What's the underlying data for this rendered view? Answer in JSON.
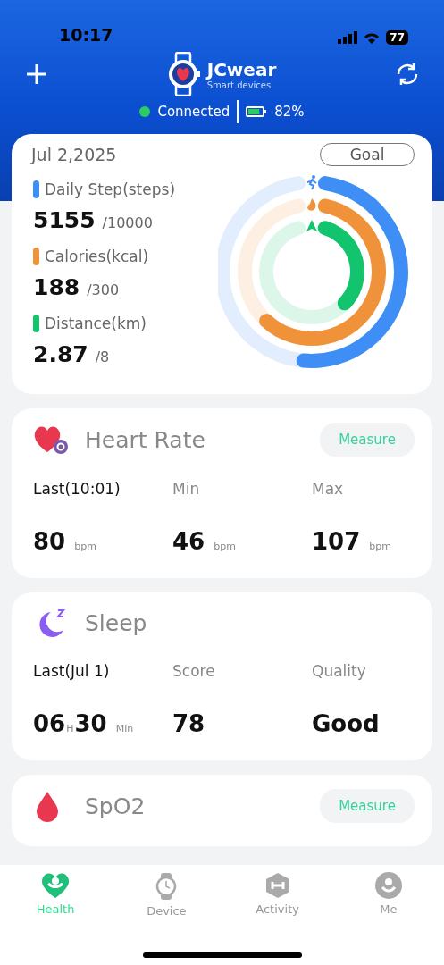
{
  "status_bar": {
    "time": "10:17",
    "battery": "77"
  },
  "header": {
    "brand": "JCwear",
    "tagline": "Smart devices",
    "connection": "Connected",
    "connected": true,
    "device_battery": "82%"
  },
  "summary": {
    "date": "Jul 2,2025",
    "goal_button": "Goal",
    "metrics": [
      {
        "kind": "steps",
        "label": "Daily Step(steps)",
        "value": "5155",
        "target": "/10000",
        "color": "#3f8ef5"
      },
      {
        "kind": "calories",
        "label": "Calories(kcal)",
        "value": "188",
        "target": "/300",
        "color": "#f0923a"
      },
      {
        "kind": "distance",
        "label": "Distance(km)",
        "value": "2.87",
        "target": "/8",
        "color": "#12c46e"
      }
    ]
  },
  "cards": [
    {
      "kind": "heart",
      "title": "Heart Rate",
      "button": "Measure",
      "stats": [
        {
          "label": "Last(10:01)",
          "emphasis": true,
          "parts": [
            {
              "text": "80",
              "unit": "bpm"
            }
          ]
        },
        {
          "label": "Min",
          "emphasis": false,
          "parts": [
            {
              "text": "46",
              "unit": "bpm"
            }
          ]
        },
        {
          "label": "Max",
          "emphasis": false,
          "parts": [
            {
              "text": "107",
              "unit": "bpm"
            }
          ]
        }
      ]
    },
    {
      "kind": "sleep",
      "title": "Sleep",
      "stats": [
        {
          "label": "Last(Jul 1)",
          "emphasis": true,
          "parts": [
            {
              "text": "06",
              "unit": "H"
            },
            {
              "text": "30",
              "unit": "Min"
            }
          ]
        },
        {
          "label": "Score",
          "emphasis": false,
          "parts": [
            {
              "text": "78"
            }
          ]
        },
        {
          "label": "Quality",
          "emphasis": false,
          "parts": [
            {
              "text": "Good"
            }
          ]
        }
      ]
    },
    {
      "kind": "spo2",
      "title": "SpO2",
      "button": "Measure"
    }
  ],
  "tabs": [
    {
      "kind": "health",
      "label": "Health",
      "selected": true
    },
    {
      "kind": "device",
      "label": "Device",
      "selected": false
    },
    {
      "kind": "activity",
      "label": "Activity",
      "selected": false
    },
    {
      "kind": "me",
      "label": "Me",
      "selected": false
    }
  ]
}
